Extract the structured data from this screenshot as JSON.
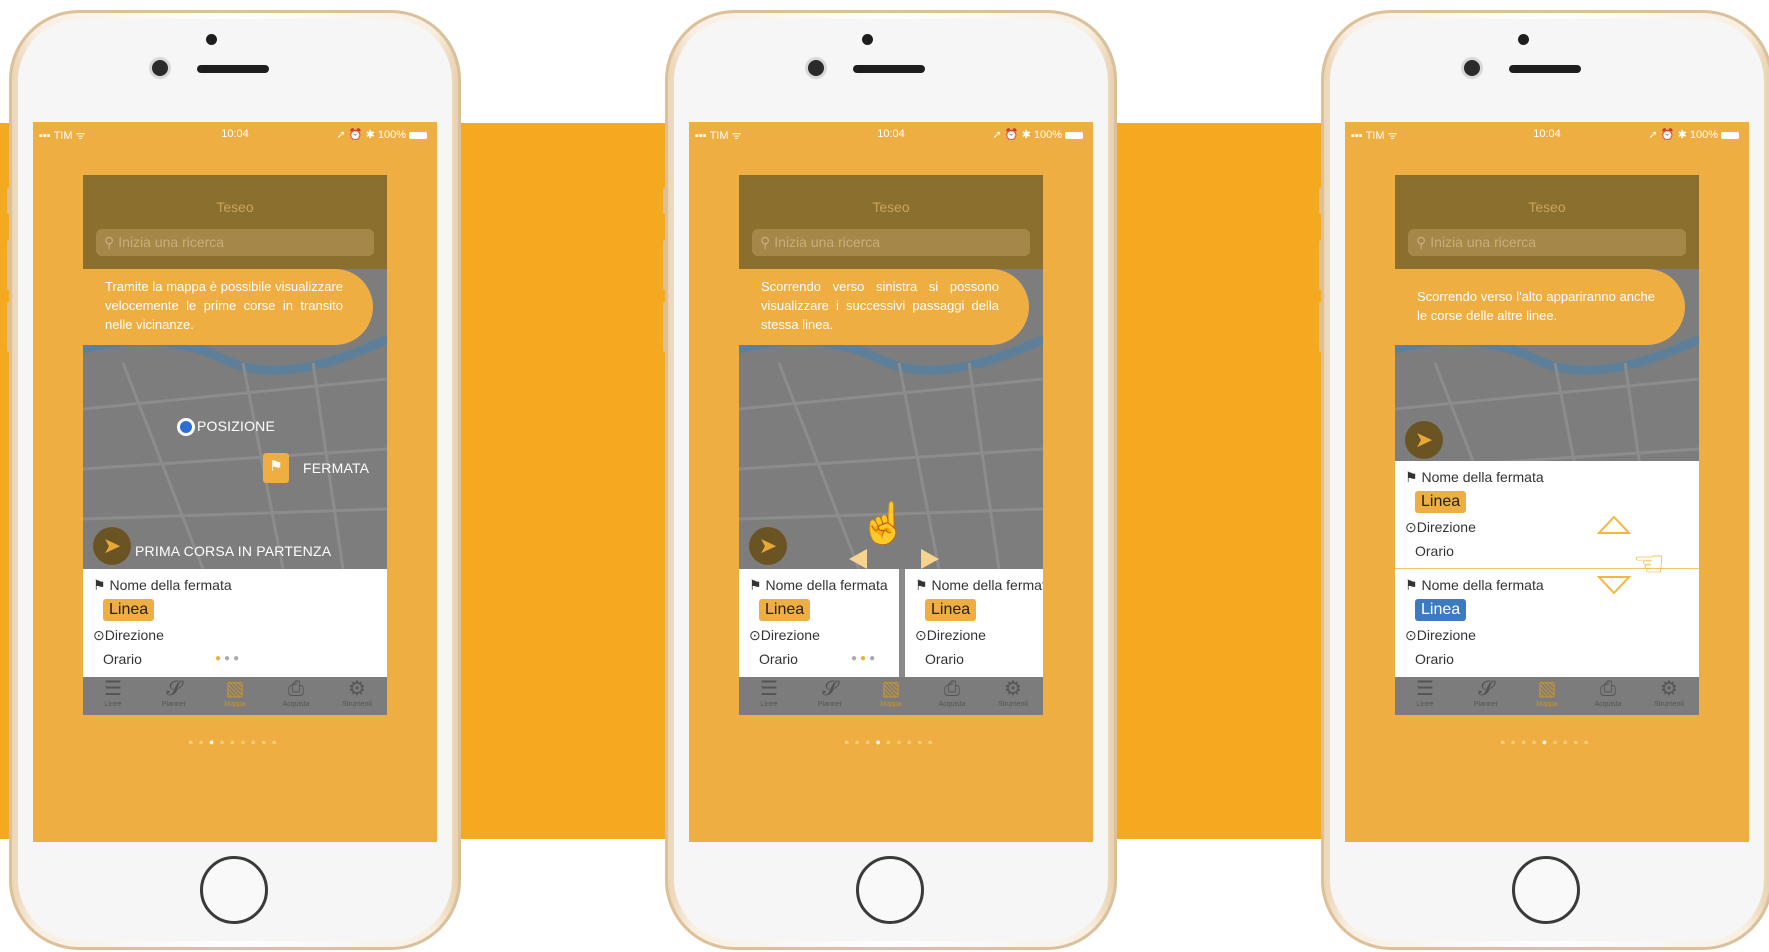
{
  "phones": [
    {
      "status": {
        "carrier": "TIM",
        "time": "10:04",
        "battery": "100%"
      },
      "app_title": "Teseo",
      "search_placeholder": "Inizia una ricerca",
      "hint": "Tramite la mappa è possibile visualizzare velocemente le prime corse in transito nelle vicinanze.",
      "map_labels": {
        "position": "POSIZIONE",
        "stop": "FERMATA",
        "first_ride": "PRIMA CORSA IN PARTENZA"
      },
      "cards": [
        {
          "name": "Nome della fermata",
          "line": "Linea",
          "direction": "Direzione",
          "time": "Orario"
        }
      ],
      "tabs": [
        "Linee",
        "Planner",
        "Mappa",
        "Acquista",
        "Strumenti"
      ],
      "active_tab": 2,
      "page_dot_active": 2
    },
    {
      "status": {
        "carrier": "TIM",
        "time": "10:04",
        "battery": "100%"
      },
      "app_title": "Teseo",
      "search_placeholder": "Inizia una ricerca",
      "hint": "Scorrendo verso sinistra si possono visualizzare i successivi passaggi della stessa linea.",
      "cards": [
        {
          "name": "Nome della fermata",
          "line": "Linea",
          "direction": "Direzione",
          "time": "Orario"
        },
        {
          "name": "Nome della fermata",
          "line": "Linea",
          "direction": "Direzione",
          "time": "Orario"
        }
      ],
      "tabs": [
        "Linee",
        "Planner",
        "Mappa",
        "Acquista",
        "Strumenti"
      ],
      "active_tab": 2,
      "page_dot_active": 3
    },
    {
      "status": {
        "carrier": "TIM",
        "time": "10:04",
        "battery": "100%"
      },
      "app_title": "Teseo",
      "search_placeholder": "Inizia una ricerca",
      "hint": "Scorrendo verso l'alto appariranno anche le corse delle altre linee.",
      "cards": [
        {
          "name": "Nome della fermata",
          "line": "Linea",
          "direction": "Direzione",
          "time": "Orario"
        },
        {
          "name": "Nome della fermata",
          "line": "Linea",
          "direction": "Direzione",
          "time": "Orario"
        }
      ],
      "tabs": [
        "Linee",
        "Planner",
        "Mappa",
        "Acquista",
        "Strumenti"
      ],
      "active_tab": 2,
      "page_dot_active": 4
    }
  ],
  "colors": {
    "background_band": "#F4A920",
    "screen": "#EFAE42",
    "header": "#8B6F2E",
    "line_badge": "#EFAE42",
    "line_badge_alt": "#3C7BC2"
  },
  "icons": {
    "location": "navigation-arrow-icon",
    "search": "search-icon",
    "stop": "flag-icon",
    "direction": "compass-icon",
    "gesture": "hand-swipe-icon"
  }
}
